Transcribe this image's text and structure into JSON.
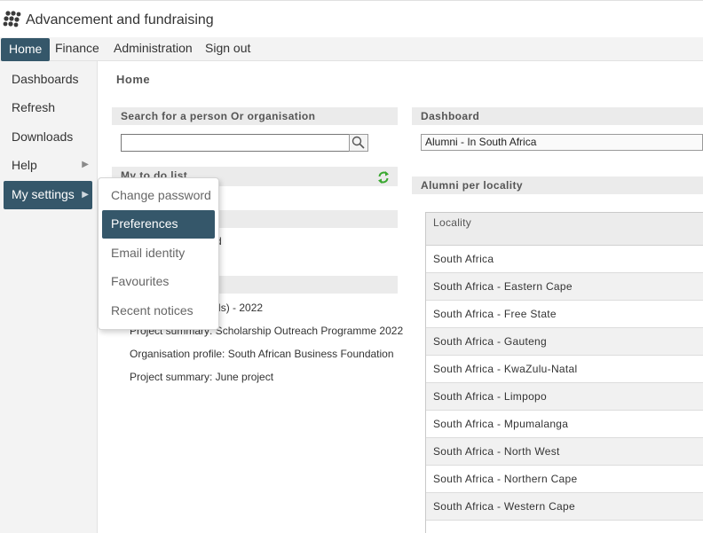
{
  "app": {
    "title": "Advancement and fundraising"
  },
  "top_nav": [
    {
      "label": "Home",
      "active": true
    },
    {
      "label": "Finance"
    },
    {
      "label": "Administration"
    },
    {
      "label": "Sign out"
    }
  ],
  "sidebar": {
    "items": [
      {
        "label": "Dashboards"
      },
      {
        "label": "Refresh"
      },
      {
        "label": "Downloads"
      },
      {
        "label": "Help",
        "has_submenu": true
      },
      {
        "label": "My settings",
        "has_submenu": true,
        "active": true
      }
    ],
    "arrow": "▶"
  },
  "settings_menu": {
    "items": [
      {
        "label": "Change password"
      },
      {
        "label": "Preferences",
        "active": true
      },
      {
        "label": "Email identity"
      },
      {
        "label": "Favourites"
      },
      {
        "label": "Recent notices"
      }
    ]
  },
  "main": {
    "breadcrumb": "Home",
    "search_panel": {
      "title": "Search for a person Or organisation",
      "value": ""
    },
    "todo_panel": {
      "title": "My to do list"
    },
    "panel3_partial_text": "d",
    "recent_items": [
      "Khumalo, Dineo (Ms) - 2022",
      "Project summary: Scholarship Outreach Programme 2022",
      "Organisation profile: South African Business Foundation",
      "Project summary: June project"
    ],
    "dashboard": {
      "title": "Dashboard",
      "selected": "Alumni - In South Africa"
    },
    "locality_panel": {
      "title": "Alumni per locality",
      "column_header": "Locality",
      "rows": [
        "South Africa",
        "South Africa - Eastern Cape",
        "South Africa - Free State",
        "South Africa - Gauteng",
        "South Africa - KwaZulu-Natal",
        "South Africa - Limpopo",
        "South Africa - Mpumalanga",
        "South Africa - North West",
        "South Africa - Northern Cape",
        "South Africa - Western Cape"
      ]
    }
  },
  "colors": {
    "accent": "#35576a",
    "panel_header": "#ebebeb",
    "sidebar_bg": "#f3f3f3",
    "refresh_icon": "#3aa830"
  }
}
